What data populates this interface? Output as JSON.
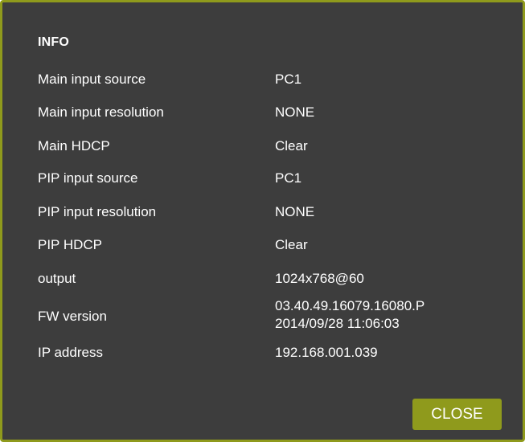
{
  "dialog": {
    "title": "INFO",
    "rows": [
      {
        "label": "Main input source",
        "value": "PC1"
      },
      {
        "label": "Main input resolution",
        "value": "NONE"
      },
      {
        "label": "Main HDCP",
        "value": "Clear"
      },
      {
        "label": "PIP input source",
        "value": "PC1"
      },
      {
        "label": "PIP input resolution",
        "value": "NONE"
      },
      {
        "label": "PIP HDCP",
        "value": "Clear"
      },
      {
        "label": "output",
        "value": "1024x768@60"
      },
      {
        "label": "FW version",
        "value_line1": "03.40.49.16079.16080.P",
        "value_line2": "2014/09/28 11:06:03"
      },
      {
        "label": "IP address",
        "value": "192.168.001.039"
      }
    ],
    "close_label": "CLOSE"
  },
  "colors": {
    "background": "#3d3d3d",
    "accent": "#8f9a1c",
    "text": "#ffffff"
  }
}
